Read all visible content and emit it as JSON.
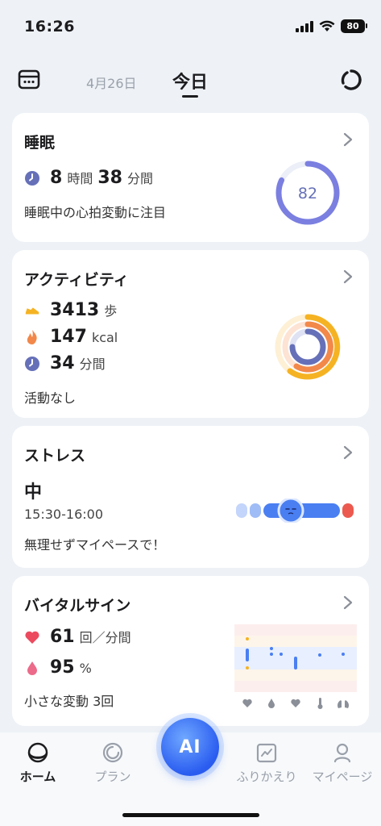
{
  "status": {
    "time": "16:26",
    "battery": "80"
  },
  "header": {
    "prev_date": "4月26日",
    "today": "今日"
  },
  "sleep": {
    "title": "睡眠",
    "hours": "8",
    "hours_unit": "時間",
    "minutes": "38",
    "minutes_unit": "分間",
    "note": "睡眠中の心拍変動に注目",
    "score": "82",
    "score_fraction": 0.82
  },
  "activity": {
    "title": "アクティビティ",
    "steps": "3413",
    "steps_unit": "歩",
    "calories": "147",
    "calories_unit": "kcal",
    "active_minutes": "34",
    "active_minutes_unit": "分間",
    "note": "活動なし"
  },
  "stress": {
    "title": "ストレス",
    "level": "中",
    "time_range": "15:30-16:00",
    "note": "無理せずマイペースで！"
  },
  "vitals": {
    "title": "バイタルサイン",
    "heart_rate": "61",
    "heart_rate_unit": "回／分間",
    "spo2": "95",
    "spo2_unit": "%",
    "note": "小さな変動 3回"
  },
  "nav": {
    "home": "ホーム",
    "plan": "プラン",
    "ai": "AI",
    "review": "ふりかえり",
    "mypage": "マイページ"
  },
  "colors": {
    "accent": "#7b7fe0",
    "steps": "#f5b323",
    "calories": "#f2884a",
    "clock": "#6670b8",
    "heart": "#ec4a5f",
    "stress": "#4a7ff2"
  }
}
